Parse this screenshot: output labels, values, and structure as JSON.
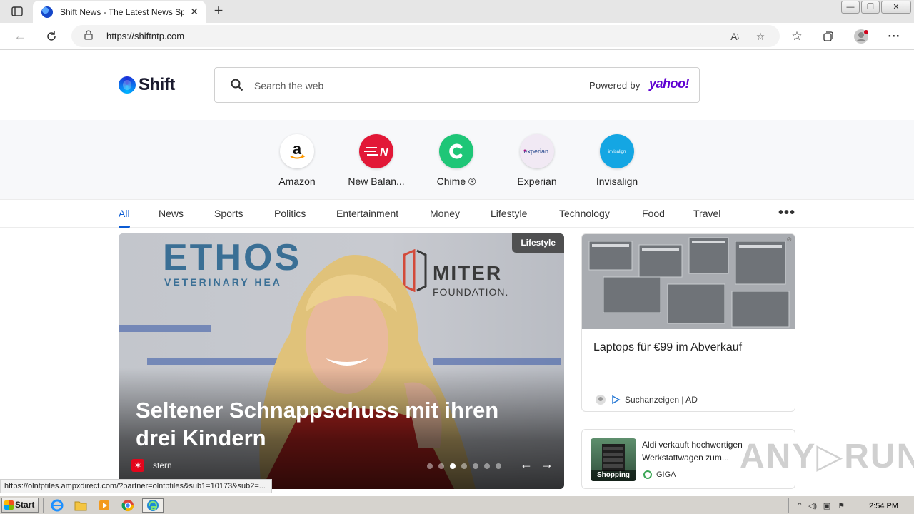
{
  "browser": {
    "tab_title": "Shift News - The Latest News Spo",
    "url": "https://shiftntp.com",
    "window_controls": [
      "—",
      "❐",
      "✕"
    ]
  },
  "page": {
    "logo_text": "Shift",
    "search": {
      "placeholder": "Search the web",
      "powered_by": "Powered by",
      "provider": "yahoo!"
    },
    "shortcuts": [
      {
        "label": "Amazon",
        "icon": "amazon-icon",
        "color": "#ffffff"
      },
      {
        "label": "New Balan...",
        "icon": "new-balance-icon",
        "color": "#e21837"
      },
      {
        "label": "Chime ®",
        "icon": "chime-icon",
        "color": "#1ec677"
      },
      {
        "label": "Experian",
        "icon": "experian-icon",
        "color": "#f1e9f4"
      },
      {
        "label": "Invisalign",
        "icon": "invisalign-icon",
        "color": "#14a6e3"
      }
    ],
    "nav": [
      "All",
      "News",
      "Sports",
      "Politics",
      "Entertainment",
      "Money",
      "Lifestyle",
      "Technology",
      "Food",
      "Travel"
    ],
    "nav_active": "All",
    "nav_more": "•••",
    "hero": {
      "badge": "Lifestyle",
      "title": "Seltener Schnappschuss mit ihren drei Kindern",
      "source": "stern",
      "source_logo": "✶",
      "brand_left": "ETHOS",
      "brand_left_sub": "VETERINARY HEA",
      "brand_right_title": "MITER",
      "brand_right_sub": "FOUNDATION.",
      "slides": 7,
      "active_slide": 3,
      "prev": "←",
      "next": "→"
    },
    "card1": {
      "title": "Laptops für €99 im Abverkauf",
      "source": "Suchanzeigen | AD"
    },
    "card2": {
      "thumb_label": "Shopping",
      "title": "Aldi verkauft hochwertigen Werkstattwagen zum...",
      "source": "GIGA"
    },
    "watermark": "ANY▷RUN"
  },
  "status_url": "https://olntptiles.ampxdirect.com/?partner=olntptiles&sub1=10173&sub2=...",
  "taskbar": {
    "start": "Start",
    "clock": "2:54 PM"
  },
  "colors": {
    "accent": "#0b5bd3",
    "yahoo": "#6001d2"
  }
}
